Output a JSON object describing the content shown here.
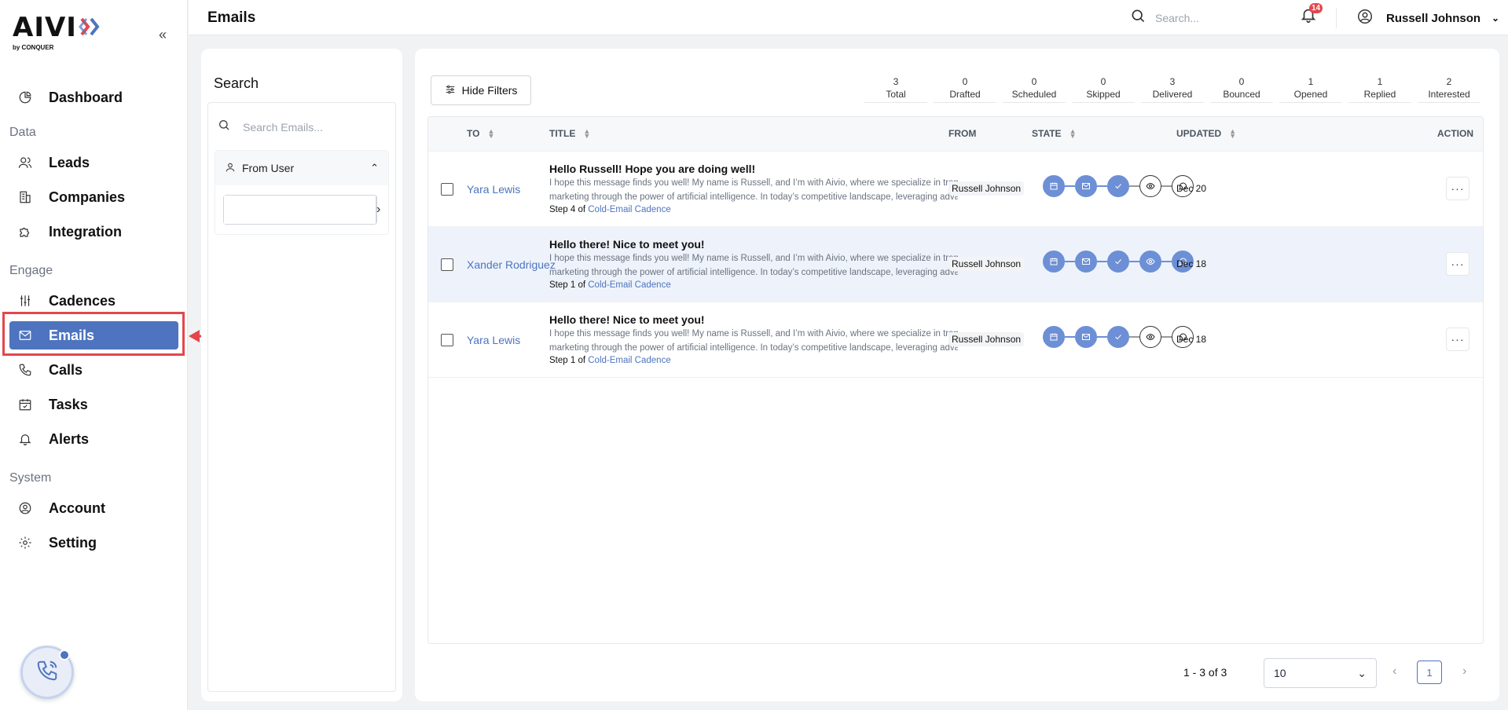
{
  "app": {
    "logo_text": "AIVI",
    "logo_sub": "by CONQUER",
    "collapse_icon": "double-chevron-left"
  },
  "sidebar": {
    "items": [
      {
        "label": "Dashboard",
        "icon": "dashboard-icon"
      },
      {
        "section": "Data"
      },
      {
        "label": "Leads",
        "icon": "users-icon"
      },
      {
        "label": "Companies",
        "icon": "building-icon"
      },
      {
        "label": "Integration",
        "icon": "puzzle-icon"
      },
      {
        "section": "Engage"
      },
      {
        "label": "Cadences",
        "icon": "sliders-icon"
      },
      {
        "label": "Emails",
        "icon": "mail-icon",
        "active": true
      },
      {
        "label": "Calls",
        "icon": "phone-icon"
      },
      {
        "label": "Tasks",
        "icon": "calendar-check-icon"
      },
      {
        "label": "Alerts",
        "icon": "bell-icon"
      },
      {
        "section": "System"
      },
      {
        "label": "Account",
        "icon": "user-circle-icon"
      },
      {
        "label": "Setting",
        "icon": "gear-icon"
      }
    ],
    "labels": {
      "dashboard": "Dashboard",
      "data": "Data",
      "leads": "Leads",
      "companies": "Companies",
      "integration": "Integration",
      "engage": "Engage",
      "cadences": "Cadences",
      "emails": "Emails",
      "calls": "Calls",
      "tasks": "Tasks",
      "alerts": "Alerts",
      "system": "System",
      "account": "Account",
      "setting": "Setting"
    }
  },
  "header": {
    "title": "Emails",
    "search_placeholder": "Search...",
    "notification_count": "14",
    "user_name": "Russell Johnson"
  },
  "search_panel": {
    "title": "Search",
    "search_placeholder": "Search Emails...",
    "from_user_label": "From User",
    "from_user_value": ""
  },
  "toolbar": {
    "hide_filters_label": "Hide Filters"
  },
  "stats": [
    {
      "count": "3",
      "label": "Total"
    },
    {
      "count": "0",
      "label": "Drafted"
    },
    {
      "count": "0",
      "label": "Scheduled"
    },
    {
      "count": "0",
      "label": "Skipped"
    },
    {
      "count": "3",
      "label": "Delivered"
    },
    {
      "count": "0",
      "label": "Bounced"
    },
    {
      "count": "1",
      "label": "Opened"
    },
    {
      "count": "1",
      "label": "Replied"
    },
    {
      "count": "2",
      "label": "Interested"
    }
  ],
  "table": {
    "columns": {
      "to": "TO",
      "title": "TITLE",
      "from": "FROM",
      "state": "STATE",
      "updated": "UPDATED",
      "action": "ACTION"
    },
    "rows": [
      {
        "to": "Yara Lewis",
        "title": "Hello Russell! Hope you are doing well!",
        "preview_1": "I hope this message finds you well! My name is Russell, and I’m with Aivio, where we specialize in transforming sales",
        "preview_2": "marketing through the power of artificial intelligence. In today’s competitive landscape, leveraging advanced…",
        "step_prefix": "Step 4 of",
        "cadence": "Cold-Email Cadence",
        "from": "Russell Johnson",
        "updated": "Dec 20",
        "action": "···",
        "state": {
          "scheduled": true,
          "delivered": true,
          "sent": true,
          "opened": false,
          "replied": false
        }
      },
      {
        "to": "Xander Rodriguez",
        "title": "Hello there! Nice to meet you!",
        "preview_1": "I hope this message finds you well! My name is Russell, and I’m with Aivio, where we specialize in transforming sales",
        "preview_2": "marketing through the power of artificial intelligence. In today’s competitive landscape, leveraging advanced…",
        "step_prefix": "Step 1 of",
        "cadence": "Cold-Email Cadence",
        "from": "Russell Johnson",
        "updated": "Dec 18",
        "action": "···",
        "state": {
          "scheduled": true,
          "delivered": true,
          "sent": true,
          "opened": true,
          "replied": true
        }
      },
      {
        "to": "Yara Lewis",
        "title": "Hello there! Nice to meet you!",
        "preview_1": "I hope this message finds you well! My name is Russell, and I’m with Aivio, where we specialize in transforming sales",
        "preview_2": "marketing through the power of artificial intelligence. In today’s competitive landscape, leveraging advanced…",
        "step_prefix": "Step 1 of",
        "cadence": "Cold-Email Cadence",
        "from": "Russell Johnson",
        "updated": "Dec 18",
        "action": "···",
        "state": {
          "scheduled": true,
          "delivered": true,
          "sent": true,
          "opened": false,
          "replied": false
        }
      }
    ]
  },
  "pagination": {
    "info": "1 - 3 of 3",
    "page_size": "10",
    "current_page": "1",
    "prev": "‹",
    "next": "›"
  },
  "colors": {
    "accent": "#4e74bf",
    "highlight": "#e3474d"
  }
}
